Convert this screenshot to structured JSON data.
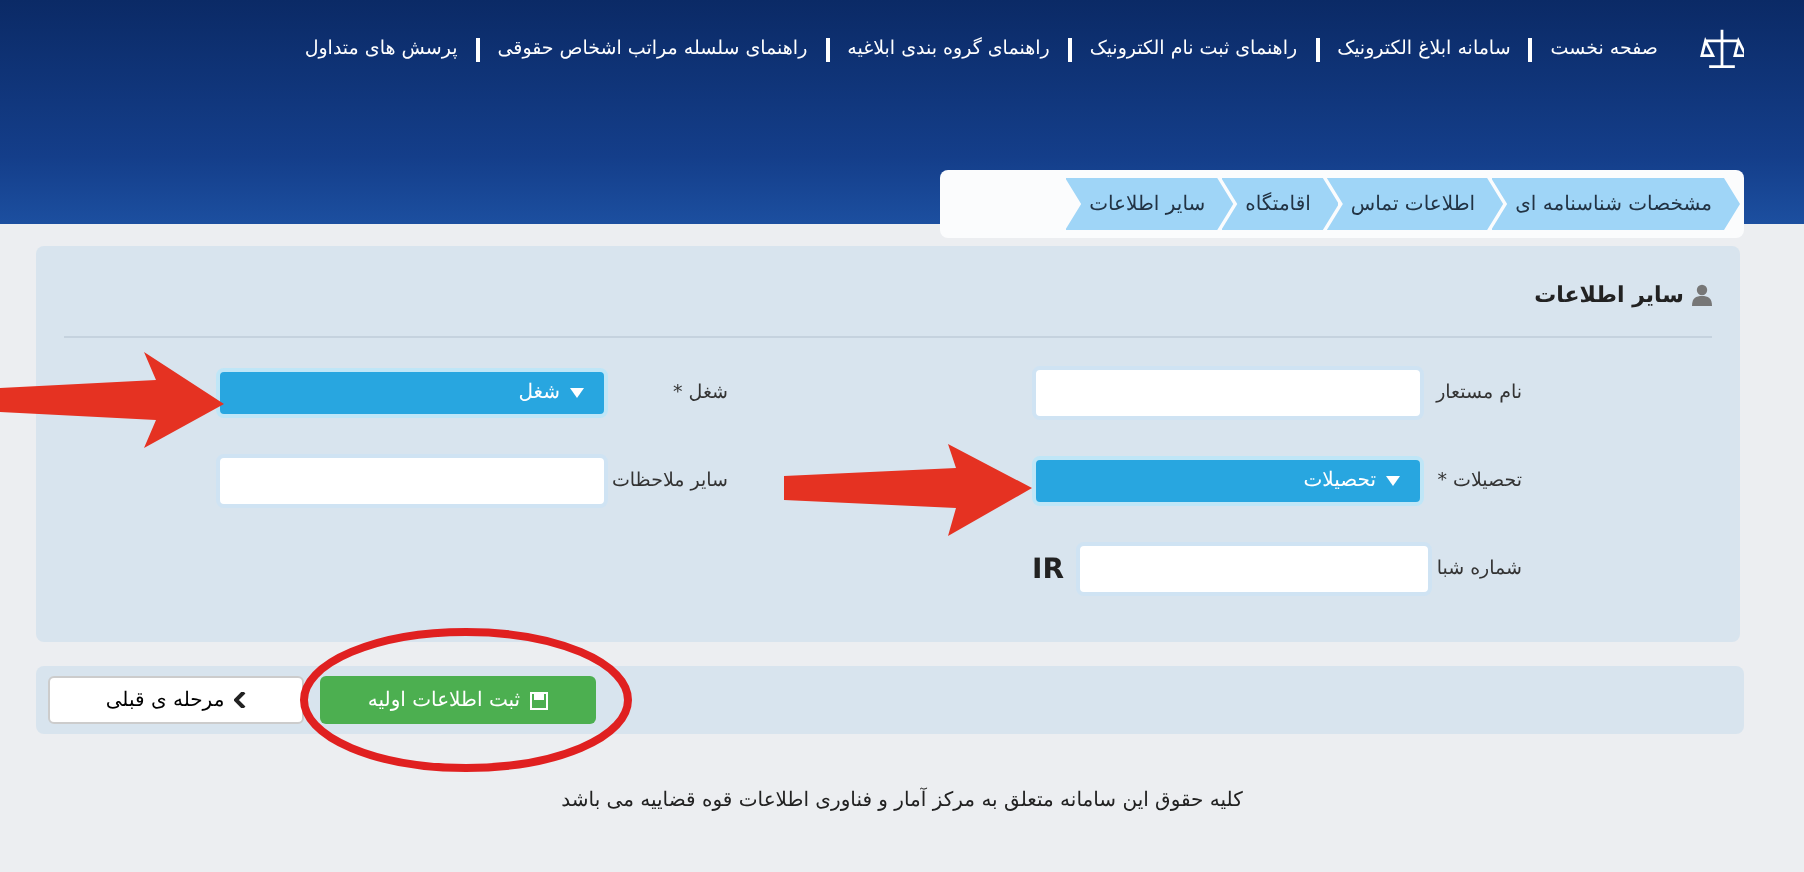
{
  "nav": {
    "items": [
      "صفحه نخست",
      "سامانه ابلاغ الکترونیک",
      "راهنمای ثبت نام الکترونیک",
      "راهنمای گروه بندی ابلاغیه",
      "راهنمای سلسله مراتب اشخاص حقوقی",
      "پرسش های متداول"
    ]
  },
  "steps": [
    "مشخصات شناسنامه ای",
    "اطلاعات تماس",
    "اقامتگاه",
    "سایر اطلاعات"
  ],
  "form": {
    "title": "سایر اطلاعات",
    "required_symbol": "*",
    "fields": [
      {
        "label": "نام مستعار",
        "kind": "text",
        "required": false
      },
      {
        "label": "شغل",
        "kind": "select",
        "required": true,
        "value": "شغل"
      },
      {
        "label": "تحصیلات",
        "kind": "select",
        "required": true,
        "value": "تحصیلات"
      },
      {
        "label": "سایر ملاحظات",
        "kind": "text",
        "required": false
      },
      {
        "label": "شماره شبا",
        "kind": "iban",
        "required": false,
        "prefix": "IR"
      }
    ]
  },
  "buttons": {
    "submit": "ثبت اطلاعات اولیه",
    "back": "مرحله ی قبلی"
  },
  "footer": "کلیه حقوق این سامانه متعلق به مرکز آمار و فناوری اطلاعات قوه قضاییه می باشد"
}
